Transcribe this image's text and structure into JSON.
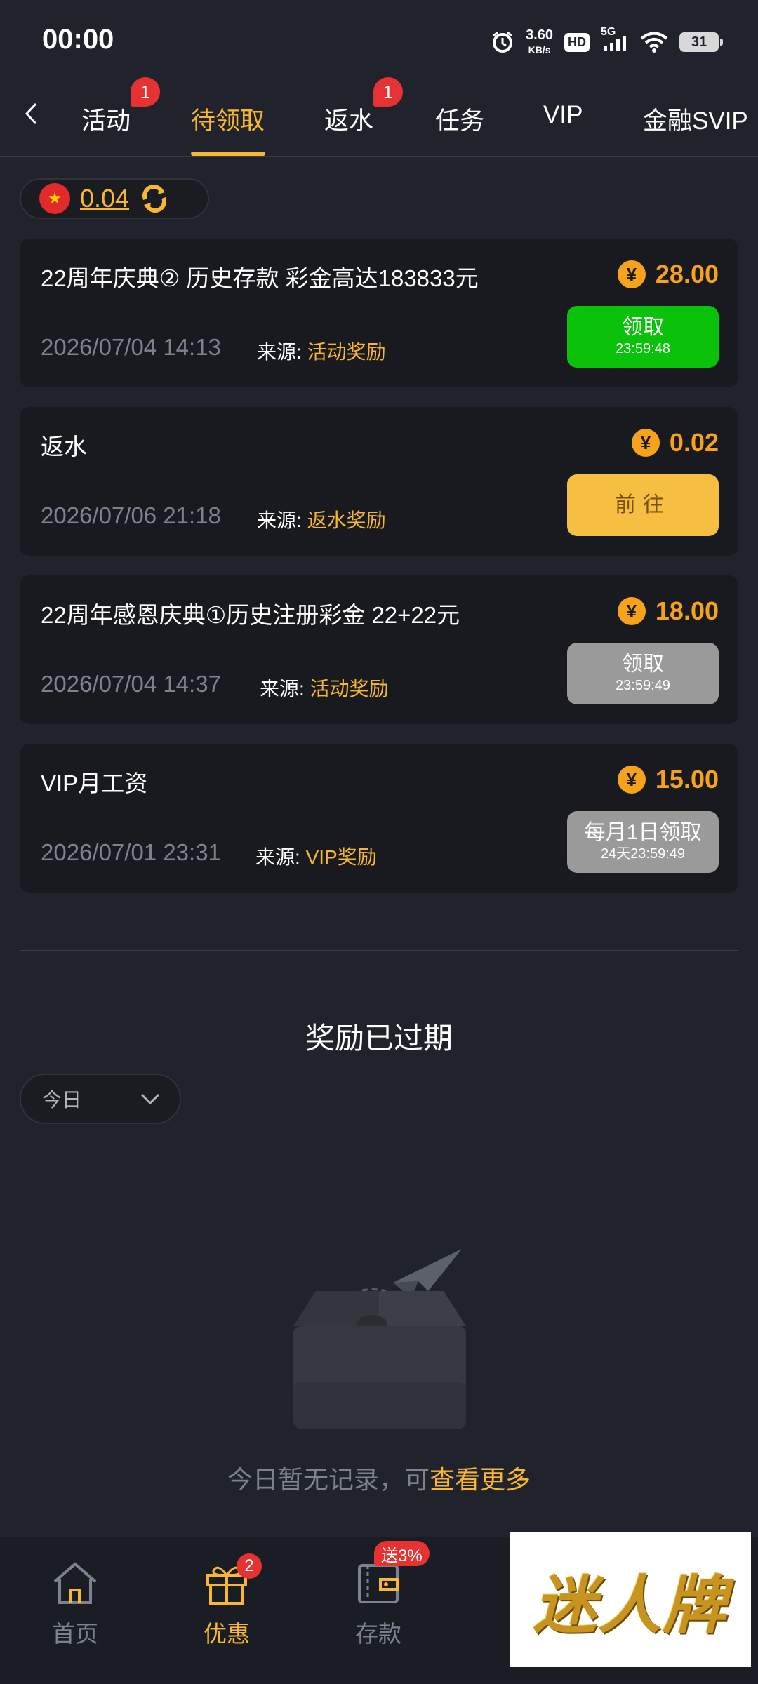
{
  "status_bar": {
    "time": "00:00",
    "net_speed_value": "3.60",
    "net_speed_unit": "KB/s",
    "hd_label": "HD",
    "signal_label": "5G",
    "battery": "31"
  },
  "tabs": [
    {
      "label": "活动",
      "badge": "1"
    },
    {
      "label": "待领取",
      "active": true
    },
    {
      "label": "返水",
      "badge": "1"
    },
    {
      "label": "任务"
    },
    {
      "label": "VIP"
    },
    {
      "label": "金融SVIP"
    }
  ],
  "balance": {
    "value": "0.04"
  },
  "rewards": [
    {
      "title": "22周年庆典② 历史存款 彩金高达183833元",
      "amount": "28.00",
      "date": "2026/07/04 14:13",
      "source_label": "来源:",
      "source": "活动奖励",
      "button_label": "领取",
      "button_sub": "23:59:48",
      "button_style": "green"
    },
    {
      "title": "返水",
      "amount": "0.02",
      "date": "2026/07/06 21:18",
      "source_label": "来源:",
      "source": "返水奖励",
      "button_label": "前往",
      "button_sub": "",
      "button_style": "yellow"
    },
    {
      "title": "22周年感恩庆典①历史注册彩金 22+22元",
      "amount": "18.00",
      "date": "2026/07/04 14:37",
      "source_label": "来源:",
      "source": "活动奖励",
      "button_label": "领取",
      "button_sub": "23:59:49",
      "button_style": "gray"
    },
    {
      "title": "VIP月工资",
      "amount": "15.00",
      "date": "2026/07/01 23:31",
      "source_label": "来源:",
      "source": "VIP奖励",
      "button_label": "每月1日领取",
      "button_sub": "24天23:59:49",
      "button_style": "gray"
    }
  ],
  "currency_symbol": "¥",
  "expired": {
    "title": "奖励已过期",
    "filter_value": "今日",
    "empty_text": "今日暂无记录，可",
    "empty_link": "查看更多"
  },
  "bottom_nav": [
    {
      "label": "首页",
      "icon": "home-icon"
    },
    {
      "label": "优惠",
      "icon": "gift-icon",
      "badge": "2",
      "active": true
    },
    {
      "label": "存款",
      "icon": "wallet-icon",
      "badge": "送3%"
    }
  ],
  "logo_overlay": {
    "text": "迷人牌"
  },
  "colors": {
    "accent": "#f7b733",
    "amount": "#f7a21b",
    "badge": "#e63232",
    "green": "#09c209",
    "gray": "#9a9a9a",
    "background": "#20232b",
    "card": "#181a20"
  }
}
